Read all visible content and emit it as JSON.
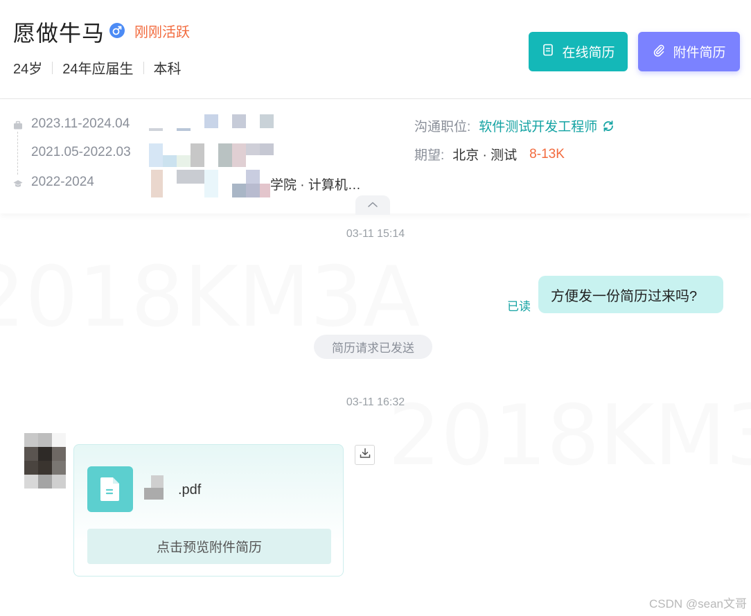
{
  "candidate": {
    "name": "愿做牛马",
    "gender_icon": "male-symbol-icon",
    "activity": "刚刚活跃",
    "age": "24岁",
    "graduation": "24年应届生",
    "degree": "本科"
  },
  "actions": {
    "online_resume": "在线简历",
    "attachment_resume": "附件简历"
  },
  "experience": [
    {
      "period": "2023.11-2024.04",
      "icon": "briefcase-icon"
    },
    {
      "period": "2021.05-2022.03",
      "icon": ""
    },
    {
      "period": "2022-2024",
      "icon": "graduation-cap-icon",
      "detail": "学院 · 计算机…"
    }
  ],
  "position": {
    "label": "沟通职位:",
    "value": "软件测试开发工程师"
  },
  "expectation": {
    "label": "期望:",
    "value": "北京 · 测试",
    "salary": "8-13K"
  },
  "chat": {
    "timestamp_1": "03-11 15:14",
    "outgoing_message": "方便发一份简历过来吗?",
    "read_status": "已读",
    "system_notice": "简历请求已发送",
    "timestamp_2": "03-11 16:32",
    "attachment": {
      "file_name": ".pdf",
      "preview_label": "点击预览附件简历"
    }
  },
  "watermark": "CSDN @sean文哥",
  "colors": {
    "accent_teal": "#14b8b8",
    "accent_purple": "#7b82ff",
    "highlight_orange": "#f26a3d",
    "bubble_bg": "#c8f2f0"
  }
}
